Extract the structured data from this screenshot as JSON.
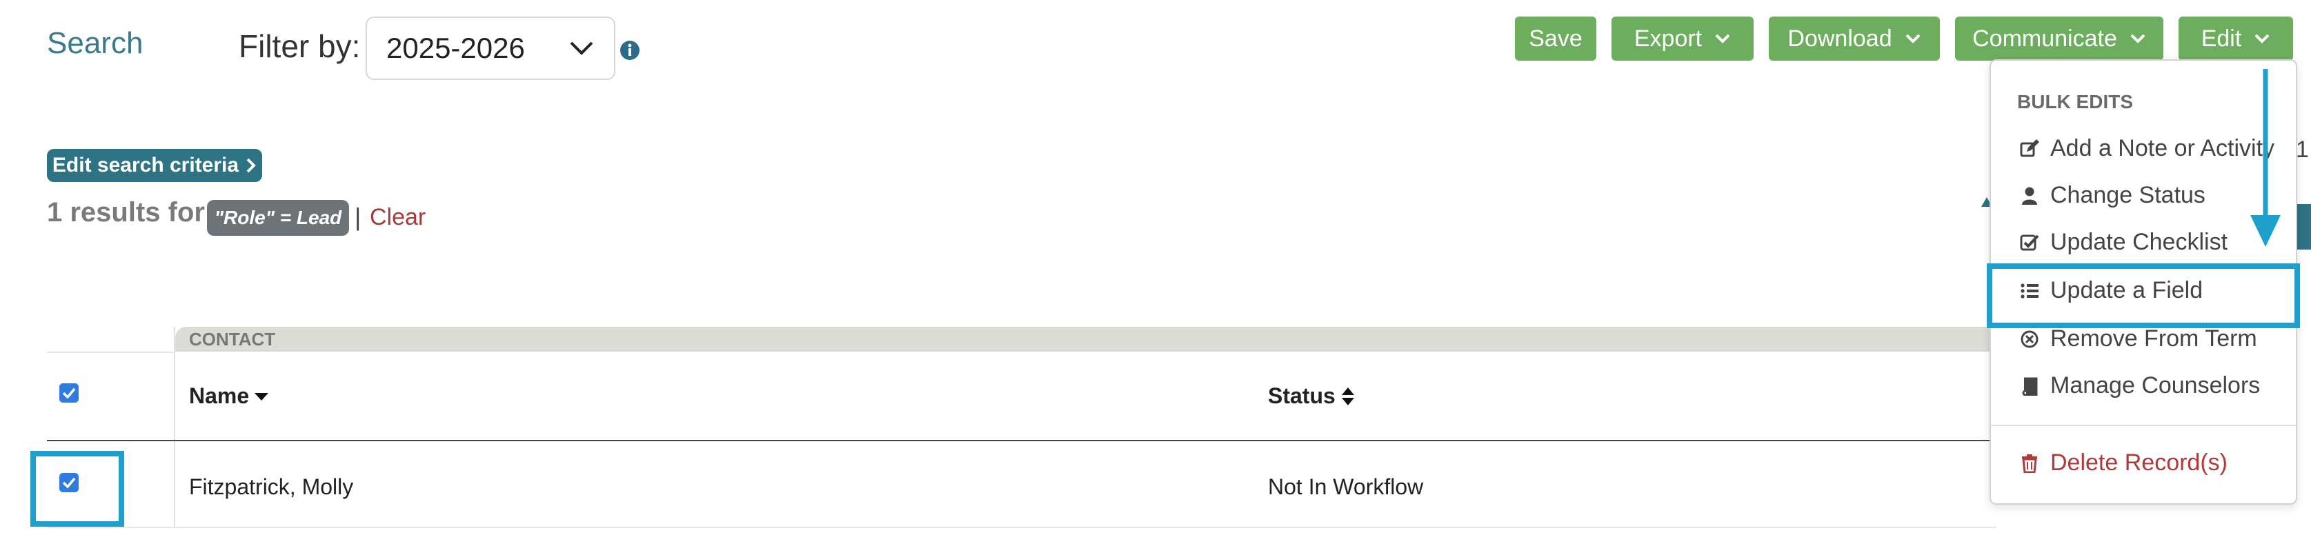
{
  "header": {
    "title": "Search",
    "filter_label": "Filter by:",
    "filter_value": "2025-2026"
  },
  "toolbar": {
    "save_label": "Save",
    "export_label": "Export",
    "download_label": "Download",
    "communicate_label": "Communicate",
    "edit_label": "Edit",
    "accent_color": "#6cae5e"
  },
  "search": {
    "edit_criteria_label": "Edit search criteria",
    "results_label": "1 results for:",
    "criteria_chip": "\"Role\" = Lead",
    "separator": "|",
    "clear_label": "Clear"
  },
  "table": {
    "group_header": "CONTACT",
    "columns": {
      "name": "Name",
      "status": "Status"
    },
    "rows": [
      {
        "name": "Fitzpatrick, Molly",
        "status": "Not In Workflow",
        "checked": true
      }
    ]
  },
  "edit_menu": {
    "section_header": "BULK EDITS",
    "items": [
      {
        "label": "Add a Note or Activity",
        "icon": "edit-icon"
      },
      {
        "label": "Change Status",
        "icon": "user-icon"
      },
      {
        "label": "Update Checklist",
        "icon": "checkbox-icon"
      },
      {
        "label": "Update a Field",
        "icon": "list-icon"
      },
      {
        "label": "Remove From Term",
        "icon": "times-circle-icon"
      },
      {
        "label": "Manage Counselors",
        "icon": "book-icon"
      },
      {
        "label": "Delete Record(s)",
        "icon": "trash-icon"
      }
    ],
    "truncated_text": "1"
  },
  "annotations": {
    "highlight_color": "#1f9fcc"
  }
}
